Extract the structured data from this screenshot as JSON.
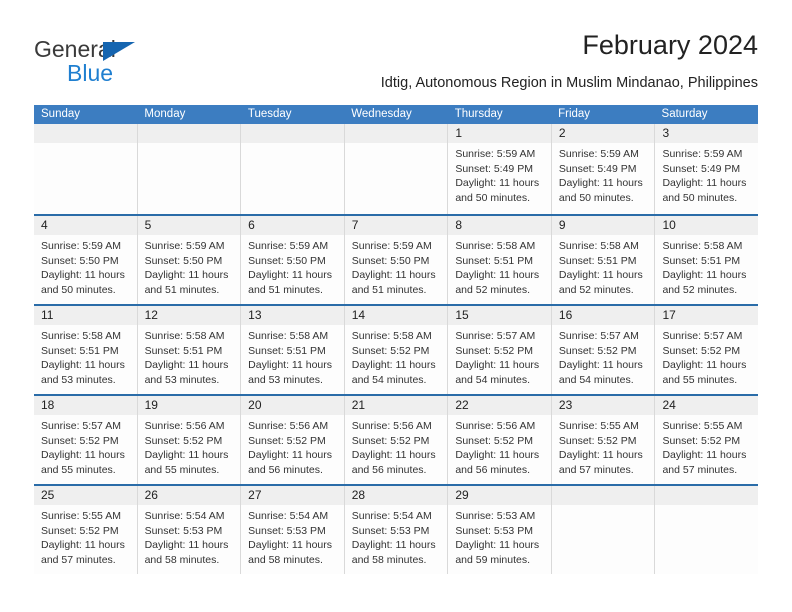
{
  "brand": {
    "name_top": "General",
    "name_bottom": "Blue",
    "triangle_color": "#1565b0",
    "blue_text_color": "#1f7fd0"
  },
  "header": {
    "title": "February 2024",
    "subtitle": "Idtig, Autonomous Region in Muslim Mindanao, Philippines"
  },
  "theme": {
    "header_blue": "#3c7dc1",
    "row_divider_blue": "#2a6ca8",
    "day_band_gray": "#efefef"
  },
  "weekdays": [
    "Sunday",
    "Monday",
    "Tuesday",
    "Wednesday",
    "Thursday",
    "Friday",
    "Saturday"
  ],
  "weeks": [
    [
      {
        "day": "",
        "lines": []
      },
      {
        "day": "",
        "lines": []
      },
      {
        "day": "",
        "lines": []
      },
      {
        "day": "",
        "lines": []
      },
      {
        "day": "1",
        "lines": [
          "Sunrise: 5:59 AM",
          "Sunset: 5:49 PM",
          "Daylight: 11 hours",
          "and 50 minutes."
        ]
      },
      {
        "day": "2",
        "lines": [
          "Sunrise: 5:59 AM",
          "Sunset: 5:49 PM",
          "Daylight: 11 hours",
          "and 50 minutes."
        ]
      },
      {
        "day": "3",
        "lines": [
          "Sunrise: 5:59 AM",
          "Sunset: 5:49 PM",
          "Daylight: 11 hours",
          "and 50 minutes."
        ]
      }
    ],
    [
      {
        "day": "4",
        "lines": [
          "Sunrise: 5:59 AM",
          "Sunset: 5:50 PM",
          "Daylight: 11 hours",
          "and 50 minutes."
        ]
      },
      {
        "day": "5",
        "lines": [
          "Sunrise: 5:59 AM",
          "Sunset: 5:50 PM",
          "Daylight: 11 hours",
          "and 51 minutes."
        ]
      },
      {
        "day": "6",
        "lines": [
          "Sunrise: 5:59 AM",
          "Sunset: 5:50 PM",
          "Daylight: 11 hours",
          "and 51 minutes."
        ]
      },
      {
        "day": "7",
        "lines": [
          "Sunrise: 5:59 AM",
          "Sunset: 5:50 PM",
          "Daylight: 11 hours",
          "and 51 minutes."
        ]
      },
      {
        "day": "8",
        "lines": [
          "Sunrise: 5:58 AM",
          "Sunset: 5:51 PM",
          "Daylight: 11 hours",
          "and 52 minutes."
        ]
      },
      {
        "day": "9",
        "lines": [
          "Sunrise: 5:58 AM",
          "Sunset: 5:51 PM",
          "Daylight: 11 hours",
          "and 52 minutes."
        ]
      },
      {
        "day": "10",
        "lines": [
          "Sunrise: 5:58 AM",
          "Sunset: 5:51 PM",
          "Daylight: 11 hours",
          "and 52 minutes."
        ]
      }
    ],
    [
      {
        "day": "11",
        "lines": [
          "Sunrise: 5:58 AM",
          "Sunset: 5:51 PM",
          "Daylight: 11 hours",
          "and 53 minutes."
        ]
      },
      {
        "day": "12",
        "lines": [
          "Sunrise: 5:58 AM",
          "Sunset: 5:51 PM",
          "Daylight: 11 hours",
          "and 53 minutes."
        ]
      },
      {
        "day": "13",
        "lines": [
          "Sunrise: 5:58 AM",
          "Sunset: 5:51 PM",
          "Daylight: 11 hours",
          "and 53 minutes."
        ]
      },
      {
        "day": "14",
        "lines": [
          "Sunrise: 5:58 AM",
          "Sunset: 5:52 PM",
          "Daylight: 11 hours",
          "and 54 minutes."
        ]
      },
      {
        "day": "15",
        "lines": [
          "Sunrise: 5:57 AM",
          "Sunset: 5:52 PM",
          "Daylight: 11 hours",
          "and 54 minutes."
        ]
      },
      {
        "day": "16",
        "lines": [
          "Sunrise: 5:57 AM",
          "Sunset: 5:52 PM",
          "Daylight: 11 hours",
          "and 54 minutes."
        ]
      },
      {
        "day": "17",
        "lines": [
          "Sunrise: 5:57 AM",
          "Sunset: 5:52 PM",
          "Daylight: 11 hours",
          "and 55 minutes."
        ]
      }
    ],
    [
      {
        "day": "18",
        "lines": [
          "Sunrise: 5:57 AM",
          "Sunset: 5:52 PM",
          "Daylight: 11 hours",
          "and 55 minutes."
        ]
      },
      {
        "day": "19",
        "lines": [
          "Sunrise: 5:56 AM",
          "Sunset: 5:52 PM",
          "Daylight: 11 hours",
          "and 55 minutes."
        ]
      },
      {
        "day": "20",
        "lines": [
          "Sunrise: 5:56 AM",
          "Sunset: 5:52 PM",
          "Daylight: 11 hours",
          "and 56 minutes."
        ]
      },
      {
        "day": "21",
        "lines": [
          "Sunrise: 5:56 AM",
          "Sunset: 5:52 PM",
          "Daylight: 11 hours",
          "and 56 minutes."
        ]
      },
      {
        "day": "22",
        "lines": [
          "Sunrise: 5:56 AM",
          "Sunset: 5:52 PM",
          "Daylight: 11 hours",
          "and 56 minutes."
        ]
      },
      {
        "day": "23",
        "lines": [
          "Sunrise: 5:55 AM",
          "Sunset: 5:52 PM",
          "Daylight: 11 hours",
          "and 57 minutes."
        ]
      },
      {
        "day": "24",
        "lines": [
          "Sunrise: 5:55 AM",
          "Sunset: 5:52 PM",
          "Daylight: 11 hours",
          "and 57 minutes."
        ]
      }
    ],
    [
      {
        "day": "25",
        "lines": [
          "Sunrise: 5:55 AM",
          "Sunset: 5:52 PM",
          "Daylight: 11 hours",
          "and 57 minutes."
        ]
      },
      {
        "day": "26",
        "lines": [
          "Sunrise: 5:54 AM",
          "Sunset: 5:53 PM",
          "Daylight: 11 hours",
          "and 58 minutes."
        ]
      },
      {
        "day": "27",
        "lines": [
          "Sunrise: 5:54 AM",
          "Sunset: 5:53 PM",
          "Daylight: 11 hours",
          "and 58 minutes."
        ]
      },
      {
        "day": "28",
        "lines": [
          "Sunrise: 5:54 AM",
          "Sunset: 5:53 PM",
          "Daylight: 11 hours",
          "and 58 minutes."
        ]
      },
      {
        "day": "29",
        "lines": [
          "Sunrise: 5:53 AM",
          "Sunset: 5:53 PM",
          "Daylight: 11 hours",
          "and 59 minutes."
        ]
      },
      {
        "day": "",
        "lines": []
      },
      {
        "day": "",
        "lines": []
      }
    ]
  ]
}
